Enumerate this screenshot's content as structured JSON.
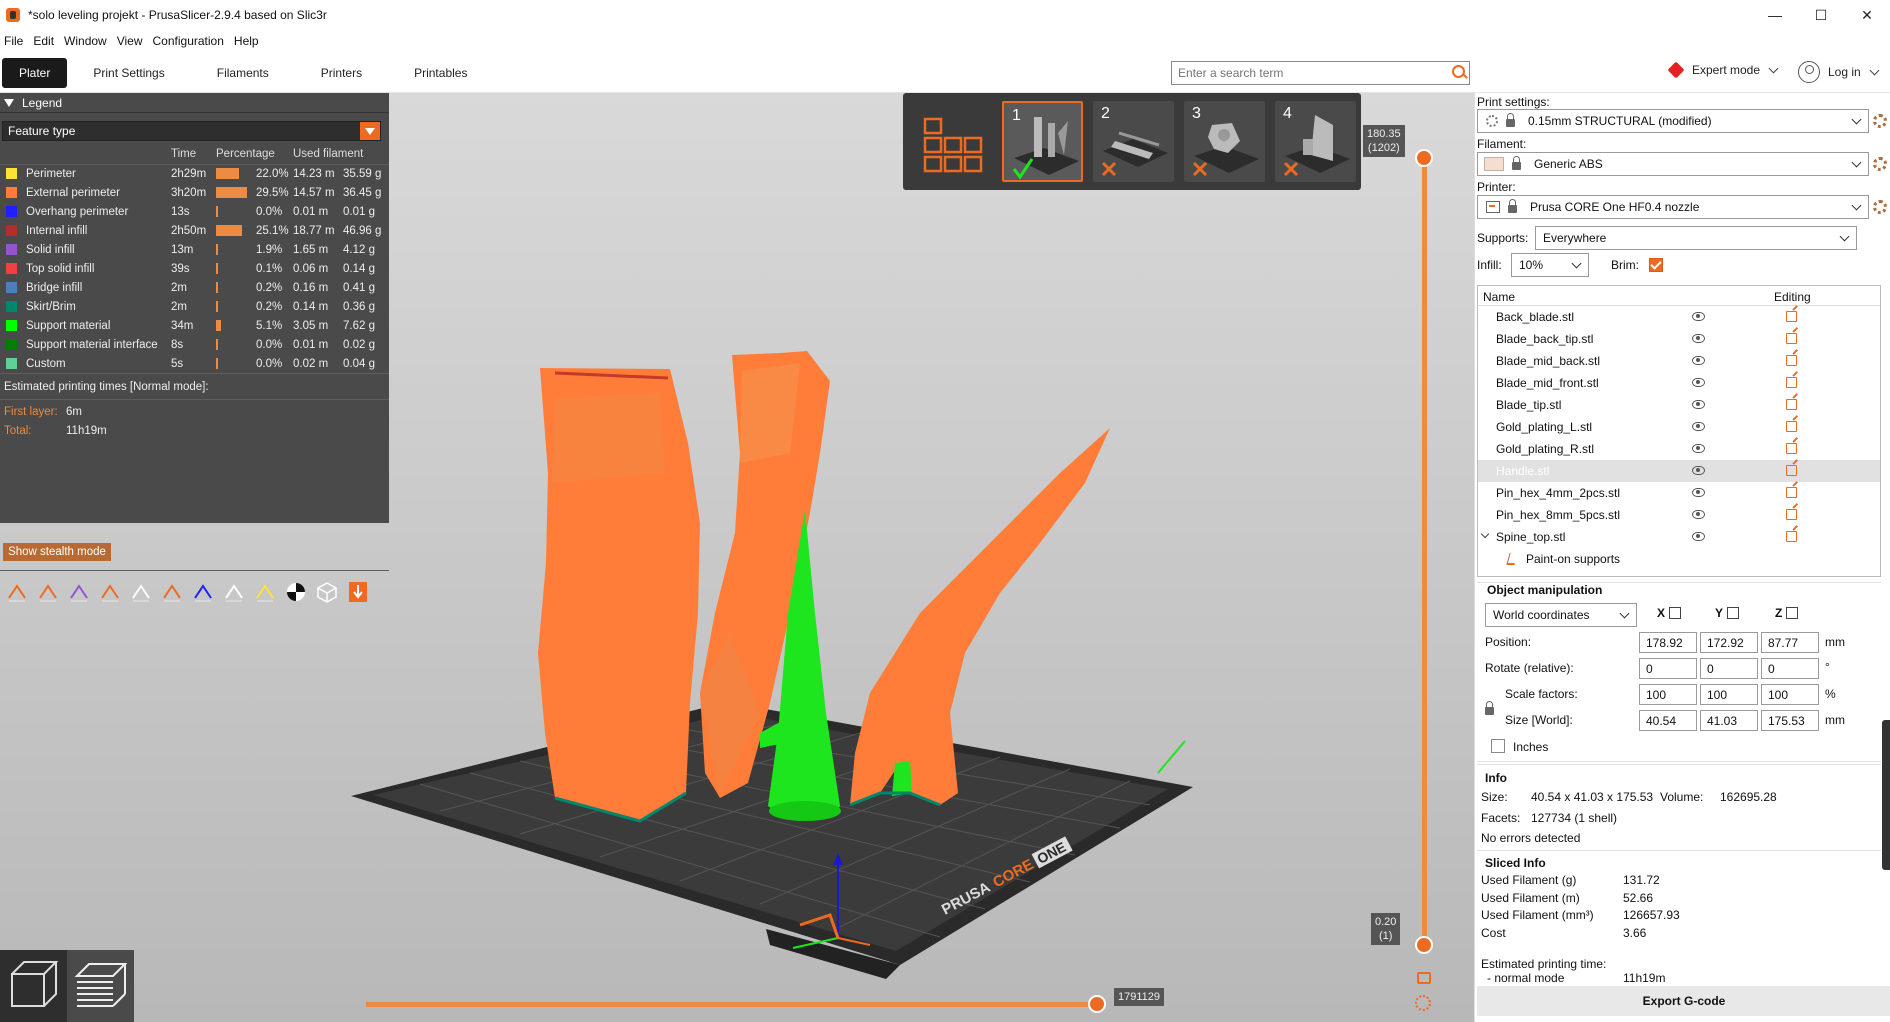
{
  "window": {
    "title": "*solo leveling projekt - PrusaSlicer-2.9.4 based on Slic3r",
    "minimize": "—",
    "maximize": "☐",
    "close": "✕"
  },
  "menu": [
    "File",
    "Edit",
    "Window",
    "View",
    "Configuration",
    "Help"
  ],
  "tabs": [
    "Plater",
    "Print Settings",
    "Filaments",
    "Printers",
    "Printables"
  ],
  "search": {
    "placeholder": "Enter a search term",
    "value": "Enter a search term"
  },
  "mode": {
    "label": "Expert mode",
    "color": "#e32323"
  },
  "login": {
    "label": "Log in"
  },
  "legend": {
    "title": "Legend",
    "view_type": "Feature type",
    "headers": {
      "time": "Time",
      "percentage": "Percentage",
      "used_filament": "Used filament"
    },
    "rows": [
      {
        "name": "Perimeter",
        "color": "#ffe233",
        "time": "2h29m",
        "pct": "22.0%",
        "pct_value": 22.0,
        "len": "14.23 m",
        "weight": "35.59 g"
      },
      {
        "name": "External perimeter",
        "color": "#ff7d38",
        "time": "3h20m",
        "pct": "29.5%",
        "pct_value": 29.5,
        "len": "14.57 m",
        "weight": "36.45 g"
      },
      {
        "name": "Overhang perimeter",
        "color": "#1f1fff",
        "time": "13s",
        "pct": "0.0%",
        "pct_value": 0.0,
        "len": "0.01 m",
        "weight": "0.01 g"
      },
      {
        "name": "Internal infill",
        "color": "#b03029",
        "time": "2h50m",
        "pct": "25.1%",
        "pct_value": 25.1,
        "len": "18.77 m",
        "weight": "46.96 g"
      },
      {
        "name": "Solid infill",
        "color": "#9654cc",
        "time": "13m",
        "pct": "1.9%",
        "pct_value": 1.9,
        "len": "1.65 m",
        "weight": "4.12 g"
      },
      {
        "name": "Top solid infill",
        "color": "#f04040",
        "time": "39s",
        "pct": "0.1%",
        "pct_value": 0.1,
        "len": "0.06 m",
        "weight": "0.14 g"
      },
      {
        "name": "Bridge infill",
        "color": "#4d80ba",
        "time": "2m",
        "pct": "0.2%",
        "pct_value": 0.2,
        "len": "0.16 m",
        "weight": "0.41 g"
      },
      {
        "name": "Skirt/Brim",
        "color": "#00876e",
        "time": "2m",
        "pct": "0.2%",
        "pct_value": 0.2,
        "len": "0.14 m",
        "weight": "0.36 g"
      },
      {
        "name": "Support material",
        "color": "#00ff00",
        "time": "34m",
        "pct": "5.1%",
        "pct_value": 5.1,
        "len": "3.05 m",
        "weight": "7.62 g"
      },
      {
        "name": "Support material interface",
        "color": "#008000",
        "time": "8s",
        "pct": "0.0%",
        "pct_value": 0.0,
        "len": "0.01 m",
        "weight": "0.02 g"
      },
      {
        "name": "Custom",
        "color": "#5ed194",
        "time": "5s",
        "pct": "0.0%",
        "pct_value": 0.0,
        "len": "0.02 m",
        "weight": "0.04 g"
      }
    ],
    "est_title": "Estimated printing times [Normal mode]:",
    "first_layer_label": "First layer:",
    "first_layer_value": "6m",
    "total_label": "Total:",
    "total_value": "11h19m",
    "stealth_button": "Show stealth mode",
    "tool_icons": [
      "travel-icon",
      "wipe-icon",
      "retraction-icon",
      "deretraction-icon",
      "seam-icon",
      "tool-change-icon",
      "color-change-icon",
      "pause-icon",
      "custom-gcode-icon",
      "center-of-gravity-icon",
      "shells-icon",
      "tool-marker-icon"
    ]
  },
  "plates": [
    "",
    "1",
    "2",
    "3",
    "4"
  ],
  "slider": {
    "top_label": "180.35",
    "top_sub": "(1202)",
    "bottom_label": "0.20",
    "bottom_sub": "(1)",
    "horizontal_label": "1791129"
  },
  "bed_brand": {
    "prusa": "PRUSA",
    "core": "CORE",
    "one": "ONE"
  },
  "sidebar": {
    "print_settings_label": "Print settings:",
    "print_settings_value": "0.15mm STRUCTURAL (modified)",
    "filament_label": "Filament:",
    "filament_value": "Generic ABS",
    "filament_color": "#f5ddd0",
    "printer_label": "Printer:",
    "printer_value": "Prusa CORE One HF0.4 nozzle",
    "supports_label": "Supports:",
    "supports_value": "Everywhere",
    "infill_label": "Infill:",
    "infill_value": "10%",
    "brim_label": "Brim:",
    "brim_checked": true
  },
  "object_list": {
    "header_name": "Name",
    "header_editing": "Editing",
    "items": [
      "Back_blade.stl",
      "Blade_back_tip.stl",
      "Blade_mid_back.stl",
      "Blade_mid_front.stl",
      "Blade_tip.stl",
      "Gold_plating_L.stl",
      "Gold_plating_R.stl",
      "Handle.stl",
      "Pin_hex_4mm_2pcs.stl",
      "Pin_hex_8mm_5pcs.stl",
      "Spine_top.stl"
    ],
    "selected_index": 7,
    "sub_item": "Paint-on supports"
  },
  "manipulation": {
    "title": "Object manipulation",
    "coord_system": "World coordinates",
    "axes": [
      "X",
      "Y",
      "Z"
    ],
    "position_label": "Position:",
    "position": [
      "178.92",
      "172.92",
      "87.77"
    ],
    "position_unit": "mm",
    "rotate_label": "Rotate (relative):",
    "rotate": [
      "0",
      "0",
      "0"
    ],
    "rotate_unit": "°",
    "scale_label": "Scale factors:",
    "scale": [
      "100",
      "100",
      "100"
    ],
    "scale_unit": "%",
    "size_label": "Size [World]:",
    "size": [
      "40.54",
      "41.03",
      "175.53"
    ],
    "size_unit": "mm",
    "inches_label": "Inches"
  },
  "info": {
    "title": "Info",
    "size_label": "Size:",
    "size_value": "40.54 x 41.03 x 175.53",
    "volume_label": "Volume:",
    "volume_value": "162695.28",
    "facets_label": "Facets:",
    "facets_value": "127734 (1 shell)",
    "errors": "No errors detected"
  },
  "sliced": {
    "title": "Sliced Info",
    "rows": [
      {
        "label": "Used Filament (g)",
        "value": "131.72"
      },
      {
        "label": "Used Filament (m)",
        "value": "52.66"
      },
      {
        "label": "Used Filament (mm³)",
        "value": "126657.93"
      },
      {
        "label": "Cost",
        "value": "3.66"
      }
    ],
    "est_label": "Estimated printing time:",
    "mode_label": "- normal mode",
    "mode_value": "11h19m"
  },
  "export_button": "Export G-code",
  "colors": {
    "accent": "#ed6b21",
    "support": "#00ff00",
    "model": "#ff7d38"
  }
}
